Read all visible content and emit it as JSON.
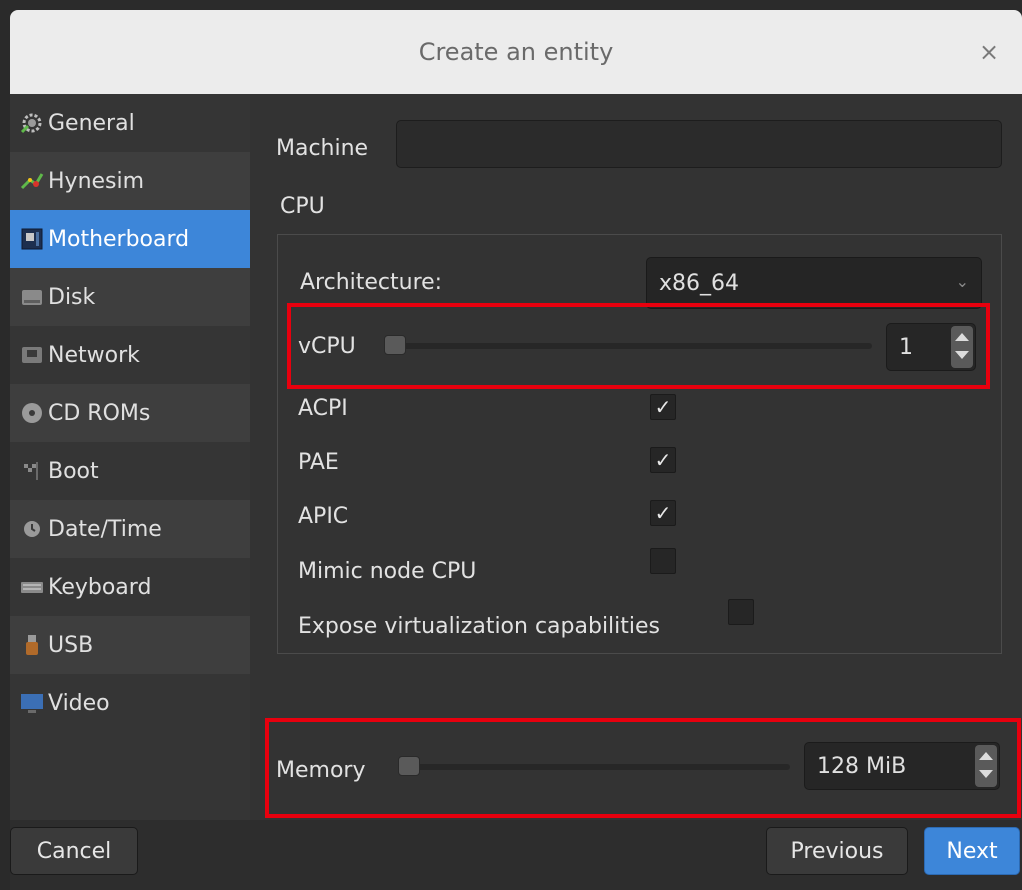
{
  "dialog": {
    "title": "Create an entity",
    "close_glyph": "×"
  },
  "sidebar": {
    "items": [
      {
        "label": "General",
        "icon": "gear-icon"
      },
      {
        "label": "Hynesim",
        "icon": "hynesim-icon"
      },
      {
        "label": "Motherboard",
        "icon": "motherboard-icon",
        "active": true
      },
      {
        "label": "Disk",
        "icon": "disk-icon"
      },
      {
        "label": "Network",
        "icon": "network-icon"
      },
      {
        "label": "CD ROMs",
        "icon": "cdrom-icon"
      },
      {
        "label": "Boot",
        "icon": "boot-icon"
      },
      {
        "label": "Date/Time",
        "icon": "clock-icon"
      },
      {
        "label": "Keyboard",
        "icon": "keyboard-icon"
      },
      {
        "label": "USB",
        "icon": "usb-icon"
      },
      {
        "label": "Video",
        "icon": "monitor-icon"
      }
    ]
  },
  "form": {
    "machine_label": "Machine",
    "machine_value": "",
    "cpu_label": "CPU",
    "architecture_label": "Architecture:",
    "architecture_value": "x86_64",
    "vcpu_label": "vCPU",
    "vcpu_value": "1",
    "acpi_label": "ACPI",
    "acpi_checked": true,
    "pae_label": "PAE",
    "pae_checked": true,
    "apic_label": "APIC",
    "apic_checked": true,
    "mimic_label": "Mimic node CPU",
    "mimic_checked": false,
    "expose_label": "Expose virtualization capabilities",
    "expose_checked": false,
    "check_glyph": "✓",
    "memory_label": "Memory",
    "memory_value": "128 MiB"
  },
  "footer": {
    "cancel_label": "Cancel",
    "previous_label": "Previous",
    "next_label": "Next"
  },
  "colors": {
    "accent": "#3d86d9",
    "highlight": "#e8000e"
  }
}
